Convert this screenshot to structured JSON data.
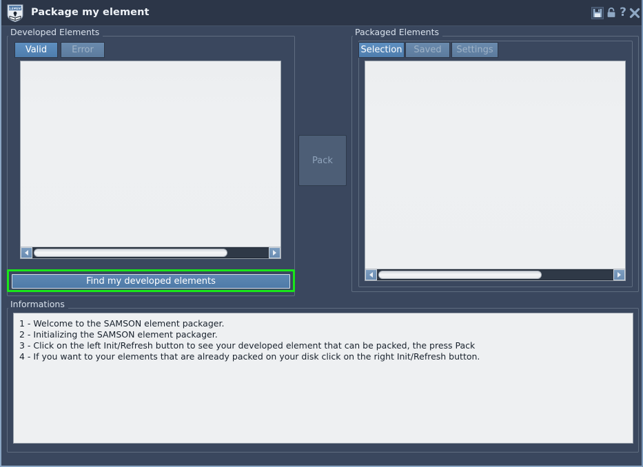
{
  "window": {
    "title": "Package my element",
    "app_icon": "element-shield-icon",
    "icon_label": "ELEMENT"
  },
  "titlebar_buttons": [
    {
      "name": "save-icon",
      "label": "Save"
    },
    {
      "name": "lock-icon",
      "label": "Lock"
    },
    {
      "name": "help-icon",
      "label": "?"
    },
    {
      "name": "close-icon",
      "label": "Close"
    }
  ],
  "developed_elements": {
    "group_label": "Developed Elements",
    "tabs": [
      {
        "label": "Valid",
        "active": true
      },
      {
        "label": "Error",
        "active": false
      }
    ],
    "list_items": [],
    "scrollbar": {
      "left_arrow": "scroll-left-icon",
      "right_arrow": "scroll-right-icon",
      "thumb_fraction": "82%"
    },
    "find_button": "Find my developed elements"
  },
  "pack_button": {
    "label": "Pack",
    "enabled": false
  },
  "packaged_elements": {
    "group_label": "Packaged Elements",
    "tabs": [
      {
        "label": "Selection",
        "active": true
      },
      {
        "label": "Saved",
        "active": false
      },
      {
        "label": "Settings",
        "active": false
      }
    ],
    "list_items": [],
    "scrollbar": {
      "left_arrow": "scroll-left-icon",
      "right_arrow": "scroll-right-icon",
      "thumb_fraction": "69%"
    }
  },
  "informations": {
    "group_label": "Informations",
    "lines": [
      "1 - Welcome to the SAMSON element packager.",
      "2 - Initializing the SAMSON element packager.",
      "3 - Click on the left Init/Refresh button to see your developed element that can be packed, the press Pack",
      "4 - If you want to your elements that are already packed on your disk click on the right Init/Refresh button."
    ]
  },
  "colors": {
    "window_background": "#3a475e",
    "titlebar_background": "#2c3648",
    "accent_blue": "#5183b5",
    "focus_green": "#19e619",
    "list_background": "#edeff1",
    "text_light": "#eef2f7",
    "text_muted": "#9fb2c6"
  }
}
